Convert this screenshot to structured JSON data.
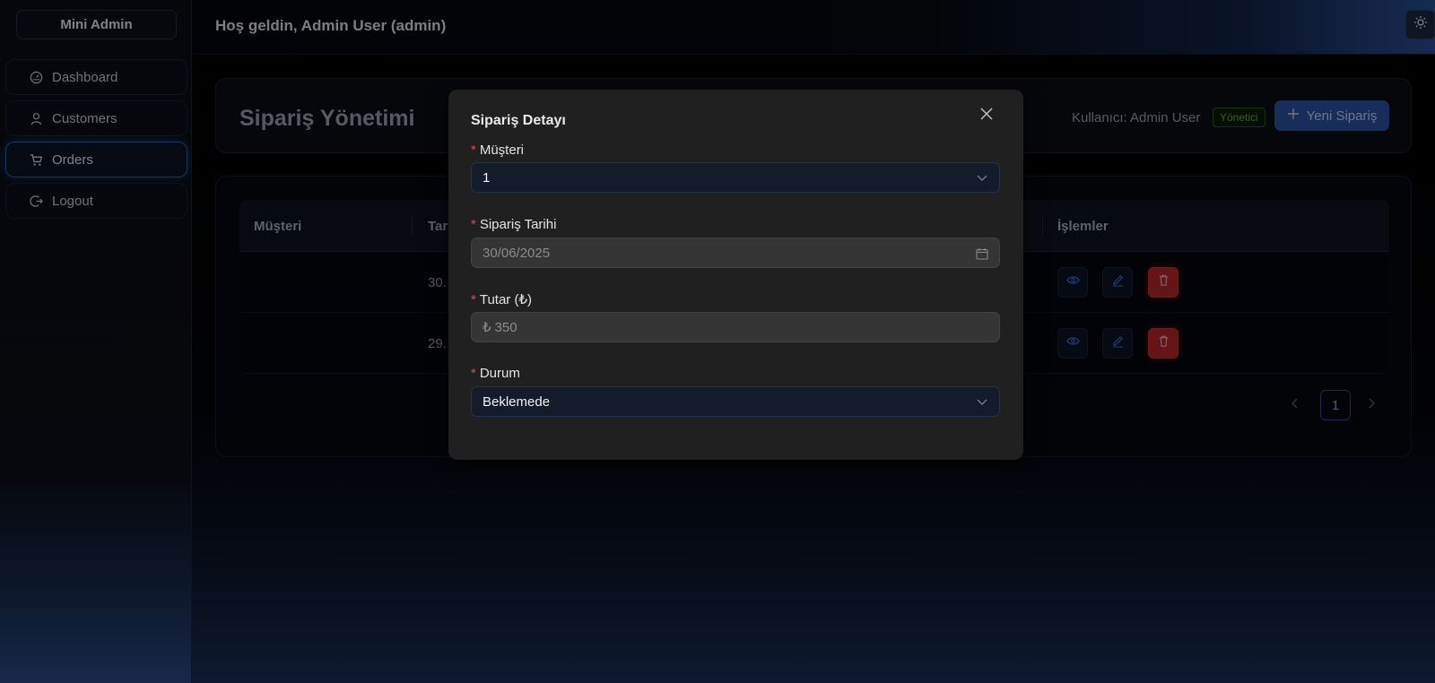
{
  "app": {
    "name": "Mini Admin"
  },
  "sidebar": {
    "items": [
      {
        "label": "Dashboard",
        "icon": "dashboard-icon"
      },
      {
        "label": "Customers",
        "icon": "user-icon"
      },
      {
        "label": "Orders",
        "icon": "cart-icon",
        "active": true
      },
      {
        "label": "Logout",
        "icon": "logout-icon"
      }
    ]
  },
  "header": {
    "welcome": "Hoş geldin, Admin User (admin)",
    "theme_icon": "sun-icon"
  },
  "page": {
    "title": "Sipariş Yönetimi",
    "user_label": "Kullanıcı: Admin User",
    "role_badge": "Yönetici",
    "new_order_label": "Yeni Sipariş"
  },
  "table": {
    "columns": [
      "Müşteri",
      "Tar",
      "İşlemler"
    ],
    "rows": [
      {
        "customer": "",
        "date": "30."
      },
      {
        "customer": "",
        "date": "29."
      }
    ]
  },
  "pagination": {
    "current": "1"
  },
  "modal": {
    "title": "Sipariş Detayı",
    "fields": {
      "customer": {
        "label": "Müşteri",
        "value": "1"
      },
      "date": {
        "label": "Sipariş Tarihi",
        "value": "30/06/2025"
      },
      "amount": {
        "label": "Tutar (₺)",
        "prefix": "₺",
        "value": "350"
      },
      "status": {
        "label": "Durum",
        "value": "Beklemede"
      }
    }
  },
  "colors": {
    "accent": "#2b55a5",
    "danger": "#b8262c",
    "badge_green": "#5fae3c"
  }
}
